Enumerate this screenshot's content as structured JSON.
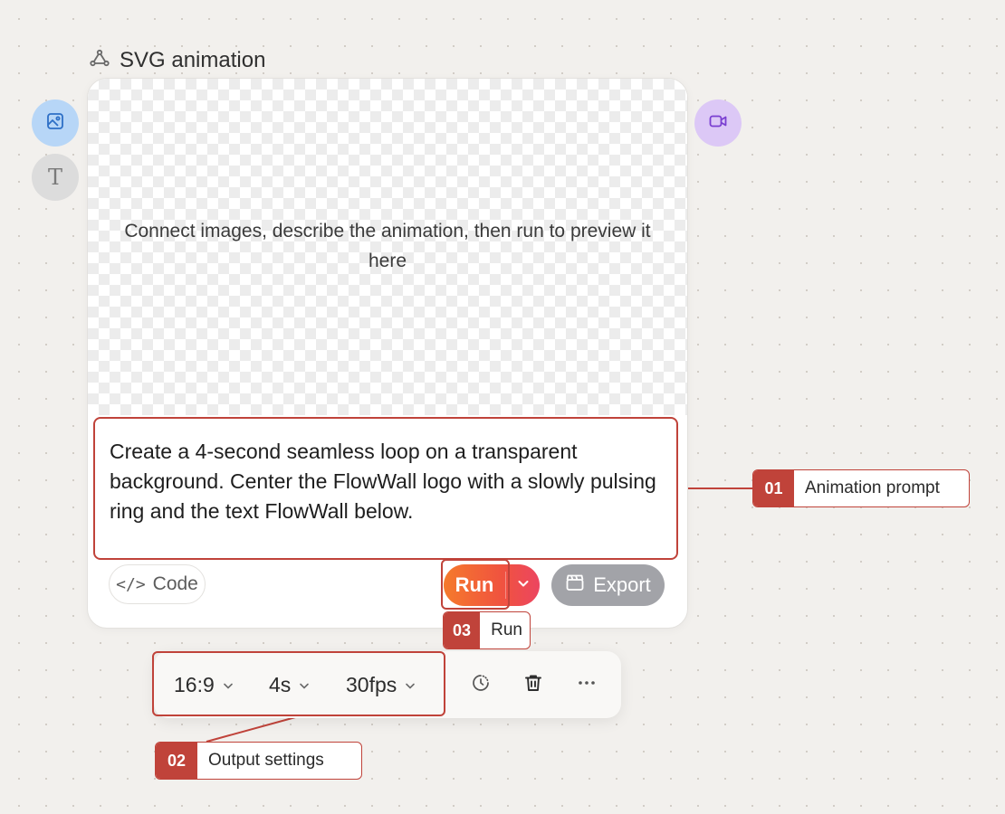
{
  "node": {
    "title": "SVG animation",
    "title_icon": "workflow-node-icon"
  },
  "handles": {
    "left": [
      {
        "name": "image-input-handle",
        "icon": "image-icon",
        "color": "#b7d6f7"
      },
      {
        "name": "text-input-handle",
        "icon": "text-icon",
        "glyph": "T",
        "color": "#dcdcdc"
      }
    ],
    "right": [
      {
        "name": "video-output-handle",
        "icon": "video-camera-icon",
        "color": "#dcc8f6"
      }
    ]
  },
  "preview": {
    "message": "Connect images, describe the animation, then run to preview it here",
    "background": "transparency-checkerboard"
  },
  "prompt": {
    "value": "Create a 4-second seamless loop on a transparent background. Center the FlowWall logo with a slowly pulsing ring and the text FlowWall below."
  },
  "actions": {
    "code_label": "Code",
    "code_icon": "</>",
    "run_label": "Run",
    "export_label": "Export"
  },
  "settings": {
    "aspect_ratio": "16:9",
    "duration": "4s",
    "fps": "30fps",
    "tools": [
      "loading-spinner-icon",
      "trash-icon",
      "more-horizontal-icon"
    ]
  },
  "callouts": [
    {
      "number": "01",
      "label": "Animation prompt"
    },
    {
      "number": "02",
      "label": "Output settings"
    },
    {
      "number": "03",
      "label": "Run"
    }
  ],
  "colors": {
    "canvas": "#f2f0ed",
    "annotation_red": "#c0433a",
    "run_gradient_start": "#f57a2c",
    "run_gradient_end": "#ec4560",
    "export_gray": "#a2a3a8"
  }
}
